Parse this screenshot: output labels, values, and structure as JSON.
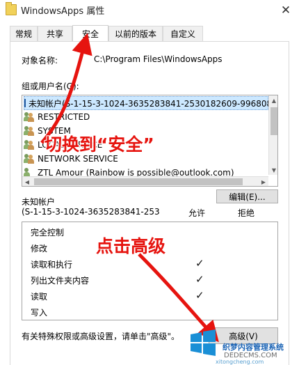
{
  "window": {
    "title": "WindowsApps 属性",
    "close_glyph": "✕"
  },
  "tabs": [
    {
      "label": "常规"
    },
    {
      "label": "共享"
    },
    {
      "label": "安全"
    },
    {
      "label": "以前的版本"
    },
    {
      "label": "自定义"
    }
  ],
  "object": {
    "label": "对象名称:",
    "value": "C:\\Program Files\\WindowsApps"
  },
  "groups": {
    "label": "组或用户名(G):",
    "items": [
      {
        "name": "未知帐户(S-1-15-3-1024-3635283841-2530182609-996808",
        "icon": "sid-icon"
      },
      {
        "name": "RESTRICTED",
        "icon": "users-icon"
      },
      {
        "name": "SYSTEM",
        "icon": "users-icon"
      },
      {
        "name": "LOCAL SERVICE",
        "icon": "users-icon"
      },
      {
        "name": "NETWORK SERVICE",
        "icon": "users-icon"
      },
      {
        "name": "ZTL Amour (Rainbow is possible@outlook.com)",
        "icon": "user-icon"
      }
    ]
  },
  "edit_button": "编辑(E)...",
  "permissions": {
    "header_line1": "未知帐户",
    "header_line2": "(S-1-15-3-1024-3635283841-253",
    "col_allow": "允许",
    "col_deny": "拒绝",
    "rows": [
      {
        "name": "完全控制",
        "allow": "",
        "deny": ""
      },
      {
        "name": "修改",
        "allow": "",
        "deny": ""
      },
      {
        "name": "读取和执行",
        "allow": "✓",
        "deny": ""
      },
      {
        "name": "列出文件夹内容",
        "allow": "✓",
        "deny": ""
      },
      {
        "name": "读取",
        "allow": "✓",
        "deny": ""
      },
      {
        "name": "写入",
        "allow": "",
        "deny": ""
      }
    ]
  },
  "footer_text": "有关特殊权限或高级设置，请单击\"高级\"。",
  "advanced_button": "高级(V)",
  "annotations": {
    "switch_security": "切换到“安全”",
    "click_advanced": "点击高级"
  },
  "watermark": {
    "name": "织梦内容管理系统",
    "domain": "DEDECMS.COM",
    "url": "xitongcheng.com"
  },
  "colors": {
    "annotation_red": "#e6140f",
    "selection": "#cce8ff"
  }
}
